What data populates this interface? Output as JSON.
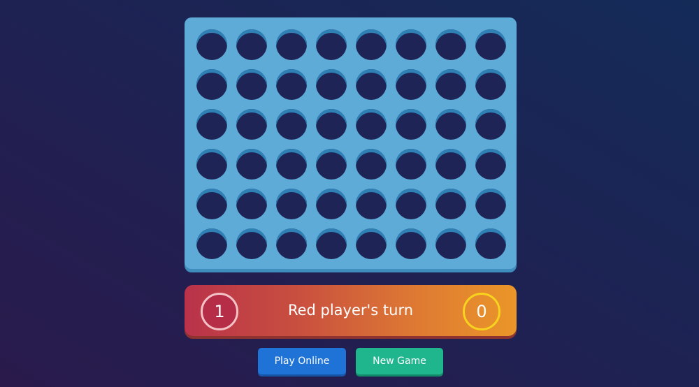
{
  "board": {
    "columns": 8,
    "rows": 6,
    "cells": [
      [
        "empty",
        "empty",
        "empty",
        "empty",
        "empty",
        "empty",
        "empty",
        "empty"
      ],
      [
        "empty",
        "empty",
        "empty",
        "empty",
        "empty",
        "empty",
        "empty",
        "empty"
      ],
      [
        "empty",
        "empty",
        "empty",
        "empty",
        "empty",
        "empty",
        "empty",
        "empty"
      ],
      [
        "empty",
        "empty",
        "empty",
        "empty",
        "empty",
        "empty",
        "empty",
        "empty"
      ],
      [
        "empty",
        "empty",
        "empty",
        "empty",
        "empty",
        "empty",
        "empty",
        "empty"
      ],
      [
        "empty",
        "empty",
        "empty",
        "empty",
        "empty",
        "empty",
        "empty",
        "empty"
      ]
    ]
  },
  "status": {
    "red_score": "1",
    "turn_text": "Red player's turn",
    "yellow_score": "0"
  },
  "buttons": {
    "play_online": "Play Online",
    "new_game": "New Game"
  },
  "colors": {
    "board": "#5eabd8",
    "hole": "#1e2455",
    "red_player": "#b62d48",
    "yellow_player": "#f7d21e",
    "play_online": "#1f72d6",
    "new_game": "#1fb68e"
  }
}
